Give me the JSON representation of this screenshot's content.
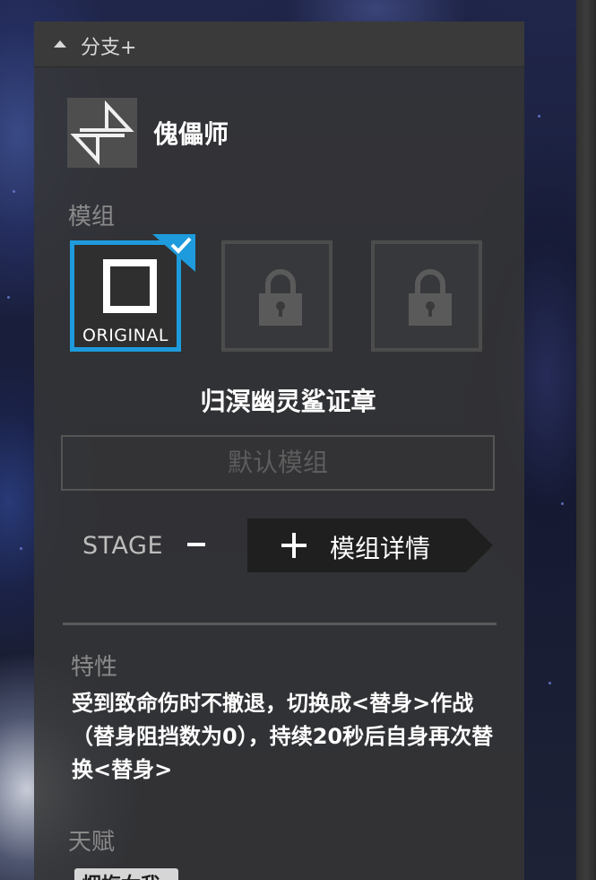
{
  "panel": {
    "title": "分支+",
    "collapse_icon": "caret-up-icon"
  },
  "profession": {
    "name": "傀儡师",
    "icon": "puppeteer-branch-icon"
  },
  "modules": {
    "section_label": "模组",
    "slots": [
      {
        "label": "ORIGINAL",
        "state": "selected",
        "icon": "square-outline-icon"
      },
      {
        "label": "",
        "state": "locked",
        "icon": "lock-icon"
      },
      {
        "label": "",
        "state": "locked",
        "icon": "lock-icon"
      }
    ],
    "selected_name": "归溟幽灵鲨证章",
    "default_button_label": "默认模组"
  },
  "stage": {
    "label": "STAGE",
    "minus_icon": "minus-icon",
    "plus_icon": "plus-icon",
    "details_label": "模组详情"
  },
  "trait": {
    "section_label": "特性",
    "text": "受到致命伤时不撤退，切换成<替身>作战（替身阻挡数为0），持续20秒后自身再次替换<替身>"
  },
  "talent": {
    "section_label": "天赋",
    "tag_label": "烟梅女我"
  },
  "colors": {
    "accent": "#1e9bdc",
    "panel_bg": "#363636",
    "label_gray": "#8a8a8a"
  }
}
